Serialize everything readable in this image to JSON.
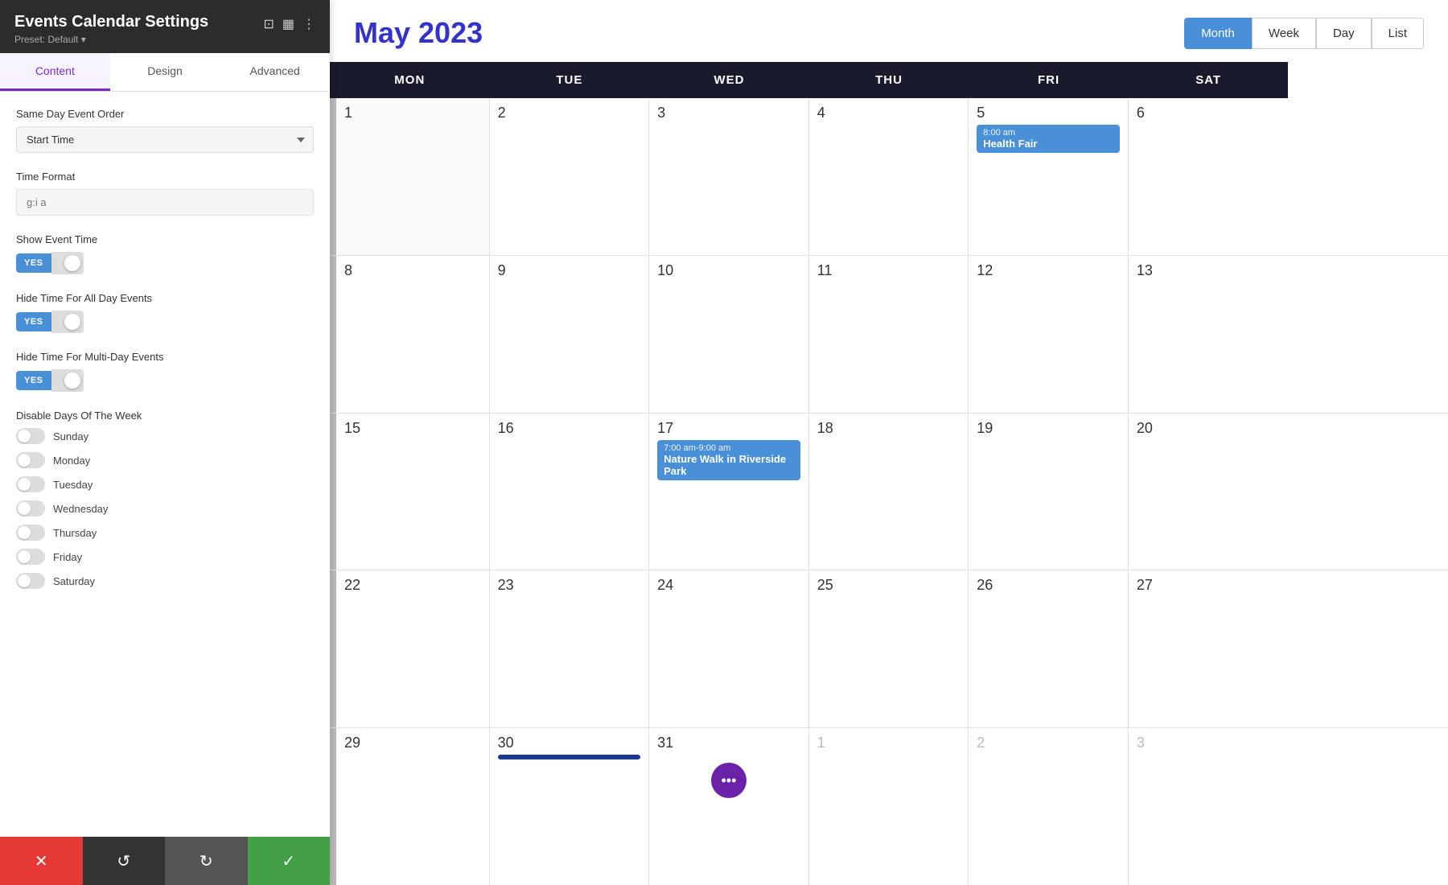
{
  "sidebar": {
    "title": "Events Calendar Settings",
    "preset": "Preset: Default ▾",
    "tabs": [
      {
        "id": "content",
        "label": "Content",
        "active": true
      },
      {
        "id": "design",
        "label": "Design",
        "active": false
      },
      {
        "id": "advanced",
        "label": "Advanced",
        "active": false
      }
    ],
    "fields": {
      "same_day_event_order": {
        "label": "Same Day Event Order",
        "value": "Start Time"
      },
      "time_format": {
        "label": "Time Format",
        "placeholder": "g:i a"
      },
      "show_event_time": {
        "label": "Show Event Time",
        "yes_label": "YES"
      },
      "hide_time_all_day": {
        "label": "Hide Time For All Day Events",
        "yes_label": "YES"
      },
      "hide_time_multi_day": {
        "label": "Hide Time For Multi-Day Events",
        "yes_label": "YES"
      },
      "disable_days": {
        "label": "Disable Days Of The Week",
        "days": [
          "Sunday",
          "Monday",
          "Tuesday",
          "Wednesday",
          "Thursday",
          "Friday",
          "Saturday"
        ]
      }
    },
    "toolbar": {
      "cancel_icon": "✕",
      "undo_icon": "↺",
      "redo_icon": "↻",
      "save_icon": "✓"
    }
  },
  "calendar": {
    "title": "May 2023",
    "view_buttons": [
      {
        "label": "Month",
        "active": true
      },
      {
        "label": "Week",
        "active": false
      },
      {
        "label": "Day",
        "active": false
      },
      {
        "label": "List",
        "active": false
      }
    ],
    "day_headers": [
      "MON",
      "TUE",
      "WED",
      "THU",
      "FRI",
      "SAT"
    ],
    "rows": [
      {
        "cells": [
          {
            "date": "1",
            "dark": false,
            "partial": true,
            "hidden": true
          },
          {
            "date": "2",
            "dark": true
          },
          {
            "date": "3",
            "dark": true
          },
          {
            "date": "4",
            "dark": true
          },
          {
            "date": "5",
            "dark": true,
            "event": {
              "time": "8:00 am",
              "name": "Health Fair",
              "color": "blue"
            }
          },
          {
            "date": "6",
            "dark": true
          }
        ]
      },
      {
        "cells": [
          {
            "date": "8",
            "dark": true,
            "partial": true
          },
          {
            "date": "9",
            "dark": true
          },
          {
            "date": "10",
            "dark": true
          },
          {
            "date": "11",
            "dark": true
          },
          {
            "date": "12",
            "dark": true
          },
          {
            "date": "13",
            "dark": true
          }
        ]
      },
      {
        "cells": [
          {
            "date": "15",
            "dark": true,
            "partial": true
          },
          {
            "date": "16",
            "dark": true
          },
          {
            "date": "17",
            "dark": true,
            "event": {
              "time": "7:00 am-9:00 am",
              "name": "Nature Walk in Riverside Park",
              "color": "blue"
            }
          },
          {
            "date": "18",
            "dark": true
          },
          {
            "date": "19",
            "dark": true
          },
          {
            "date": "20",
            "dark": true
          }
        ]
      },
      {
        "cells": [
          {
            "date": "22",
            "dark": true,
            "partial": true
          },
          {
            "date": "23",
            "dark": true
          },
          {
            "date": "24",
            "dark": true
          },
          {
            "date": "25",
            "dark": true
          },
          {
            "date": "26",
            "dark": true
          },
          {
            "date": "27",
            "dark": true
          }
        ]
      },
      {
        "cells": [
          {
            "date": "29",
            "dark": true,
            "partial": true
          },
          {
            "date": "30",
            "dark": true
          },
          {
            "date": "31",
            "dark": true,
            "more": true
          },
          {
            "date": "1",
            "dark": false,
            "gray": true
          },
          {
            "date": "2",
            "dark": false,
            "gray": true
          },
          {
            "date": "3",
            "dark": false,
            "gray": true
          }
        ]
      }
    ],
    "events": {
      "health_fair": {
        "time": "8:00 am",
        "name": "Health Fair"
      },
      "nature_walk": {
        "time": "7:00 am-9:00 am",
        "name": "Nature Walk in Riverside Park"
      }
    }
  }
}
